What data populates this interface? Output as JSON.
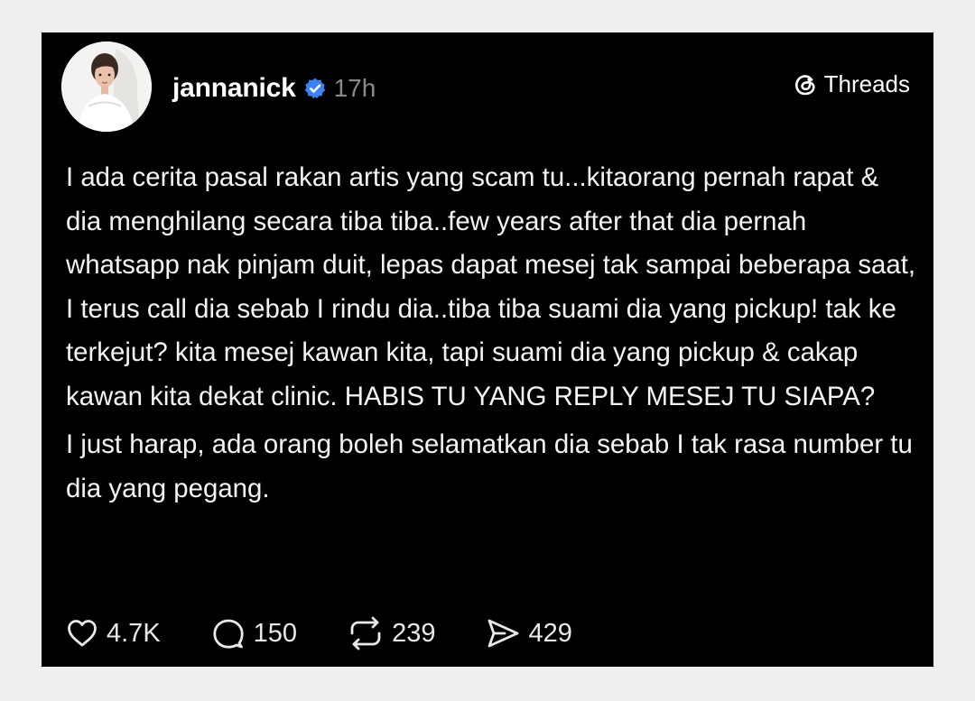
{
  "post": {
    "username": "jannanick",
    "time": "17h",
    "platform": "Threads",
    "text": [
      "I ada cerita  pasal rakan artis yang scam tu...kitaorang pernah rapat & dia menghilang secara tiba tiba..few years after that dia pernah whatsapp nak pinjam duit, lepas dapat mesej tak sampai beberapa saat, I terus call dia sebab I rindu dia..tiba tiba suami dia yang pickup! tak ke terkejut? kita mesej kawan kita, tapi suami dia yang pickup & cakap kawan kita dekat clinic. HABIS TU YANG REPLY MESEJ TU SIAPA?",
      "I just harap, ada orang boleh selamatkan dia sebab I tak rasa number tu dia yang pegang."
    ]
  },
  "actions": {
    "likes": "4.7K",
    "comments": "150",
    "reposts": "239",
    "shares": "429"
  },
  "icons": {
    "like": "heart-icon",
    "comment": "comment-icon",
    "repost": "repost-icon",
    "share": "send-icon",
    "verified": "verified-badge-icon",
    "brand": "threads-logo-icon"
  },
  "colors": {
    "card_background": "#000000",
    "page_background": "#efefef",
    "verified": "#3b82f6",
    "timestamp": "#8a8a8a"
  }
}
